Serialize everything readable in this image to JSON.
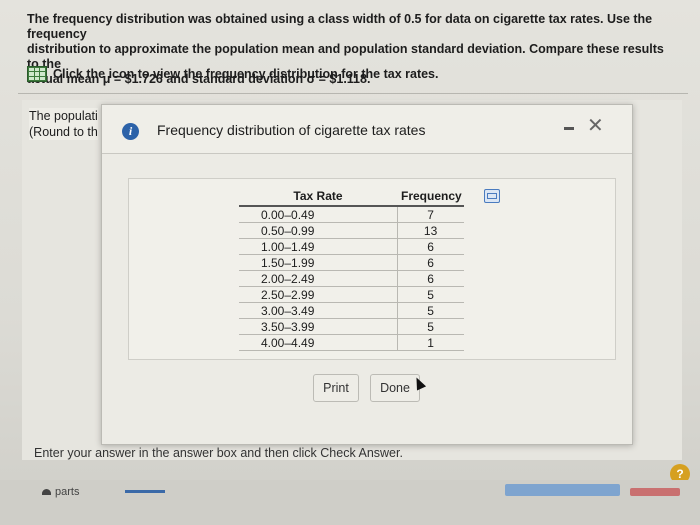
{
  "question": {
    "line1": "The frequency distribution was obtained using a class width of 0.5 for data on cigarette tax rates. Use the frequency",
    "line2": "distribution to approximate the population mean and population standard deviation. Compare these results to the",
    "line3": "actual mean μ = $1.726 and standard deviation σ = $1.118."
  },
  "icon_prompt": "Click the icon to view the frequency distribution for the tax rates.",
  "behind_text": {
    "line1": "The populati",
    "line2": "(Round to th"
  },
  "modal": {
    "title": "Frequency distribution of cigarette tax rates",
    "print_label": "Print",
    "done_label": "Done"
  },
  "table": {
    "headers": [
      "Tax Rate",
      "Frequency"
    ],
    "rows": [
      {
        "rate": "0.00–0.49",
        "freq": "7"
      },
      {
        "rate": "0.50–0.99",
        "freq": "13"
      },
      {
        "rate": "1.00–1.49",
        "freq": "6"
      },
      {
        "rate": "1.50–1.99",
        "freq": "6"
      },
      {
        "rate": "2.00–2.49",
        "freq": "6"
      },
      {
        "rate": "2.50–2.99",
        "freq": "5"
      },
      {
        "rate": "3.00–3.49",
        "freq": "5"
      },
      {
        "rate": "3.50–3.99",
        "freq": "5"
      },
      {
        "rate": "4.00–4.49",
        "freq": "1"
      }
    ]
  },
  "instruction": "Enter your answer in the answer box and then click Check Answer.",
  "help_label": "?",
  "parts_label": "parts"
}
